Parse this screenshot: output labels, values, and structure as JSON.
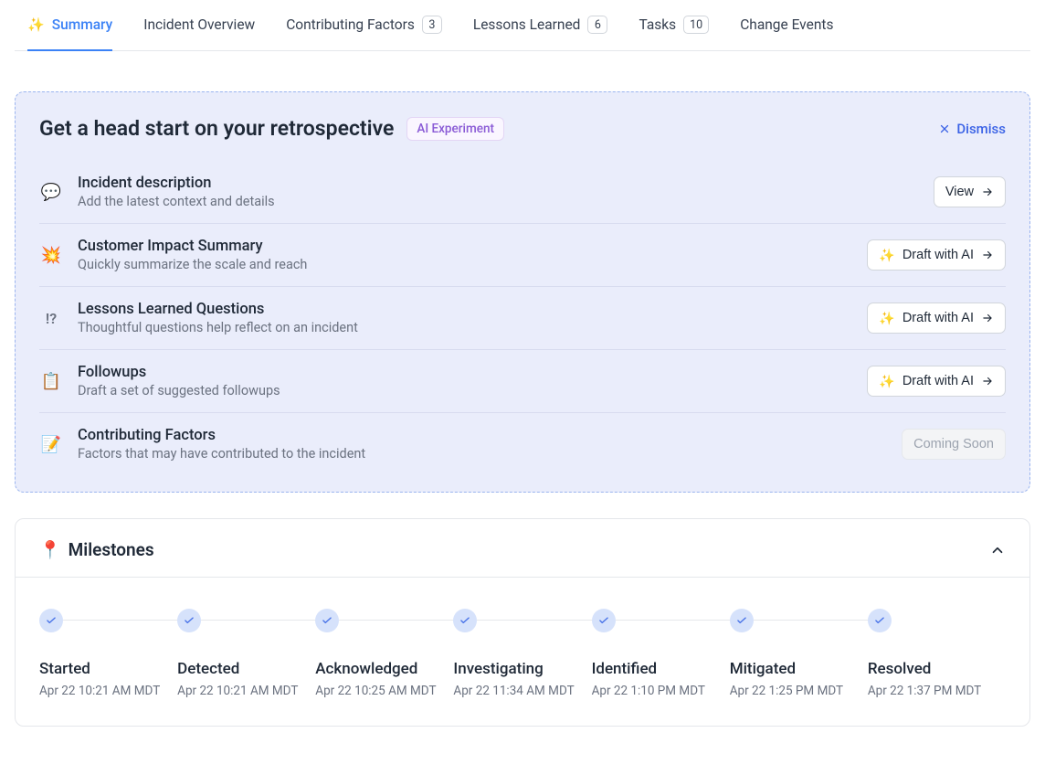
{
  "tabs": [
    {
      "label": "Summary",
      "active": true,
      "sparkle": true,
      "badge": null
    },
    {
      "label": "Incident Overview",
      "active": false,
      "badge": null
    },
    {
      "label": "Contributing Factors",
      "active": false,
      "badge": "3"
    },
    {
      "label": "Lessons Learned",
      "active": false,
      "badge": "6"
    },
    {
      "label": "Tasks",
      "active": false,
      "badge": "10"
    },
    {
      "label": "Change Events",
      "active": false,
      "badge": null
    }
  ],
  "retro": {
    "title": "Get a head start on your retrospective",
    "ai_badge": "AI Experiment",
    "dismiss": "Dismiss",
    "items": [
      {
        "emoji": "💬",
        "title": "Incident description",
        "desc": "Add the latest context and details",
        "btn": "View",
        "btn_type": "view"
      },
      {
        "emoji": "💥",
        "title": "Customer Impact Summary",
        "desc": "Quickly summarize the scale and reach",
        "btn": "Draft with AI",
        "btn_type": "ai"
      },
      {
        "emoji": "!?",
        "title": "Lessons Learned Questions",
        "desc": "Thoughtful questions help reflect on an incident",
        "btn": "Draft with AI",
        "btn_type": "ai"
      },
      {
        "emoji": "📋",
        "title": "Followups",
        "desc": "Draft a set of suggested followups",
        "btn": "Draft with AI",
        "btn_type": "ai"
      },
      {
        "emoji": "📝",
        "title": "Contributing Factors",
        "desc": "Factors that may have contributed to the incident",
        "btn": "Coming Soon",
        "btn_type": "disabled"
      }
    ]
  },
  "milestones": {
    "title": "Milestones",
    "pin": "📍",
    "steps": [
      {
        "label": "Started",
        "time": "Apr 22 10:21 AM MDT"
      },
      {
        "label": "Detected",
        "time": "Apr 22 10:21 AM MDT"
      },
      {
        "label": "Acknowledged",
        "time": "Apr 22 10:25 AM MDT"
      },
      {
        "label": "Investigating",
        "time": "Apr 22 11:34 AM MDT"
      },
      {
        "label": "Identified",
        "time": "Apr 22 1:10 PM MDT"
      },
      {
        "label": "Mitigated",
        "time": "Apr 22 1:25 PM MDT"
      },
      {
        "label": "Resolved",
        "time": "Apr 22 1:37 PM MDT"
      }
    ]
  }
}
